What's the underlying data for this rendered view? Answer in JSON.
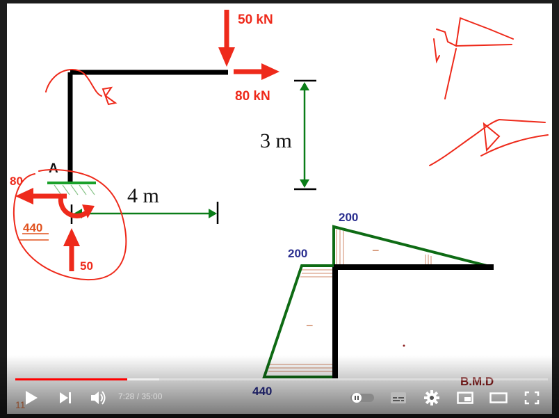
{
  "diagram": {
    "load_top": "50 kN",
    "load_right": "80 kN",
    "height_label": "3 m",
    "span_label": "4 m",
    "point_label": "A",
    "reaction_horizontal": "80",
    "reaction_moment": "440",
    "reaction_vertical": "50"
  },
  "bmd": {
    "title": "B.M.D",
    "top_value": "200",
    "corner_value": "200",
    "bottom_value": "440",
    "sign_beam": "−",
    "sign_column": "−"
  },
  "player": {
    "time": "7:28 / 35:00",
    "played_fraction": 0.21,
    "buffered_fraction": 0.27,
    "corner_number": "11"
  },
  "colors": {
    "load": "#ee2a1b",
    "dimension": "#0a7d18",
    "label_blue": "#2a2e8f",
    "bmd_title": "#8b1c1c",
    "hatch": "#c8754a",
    "progress": "#ff0000"
  }
}
